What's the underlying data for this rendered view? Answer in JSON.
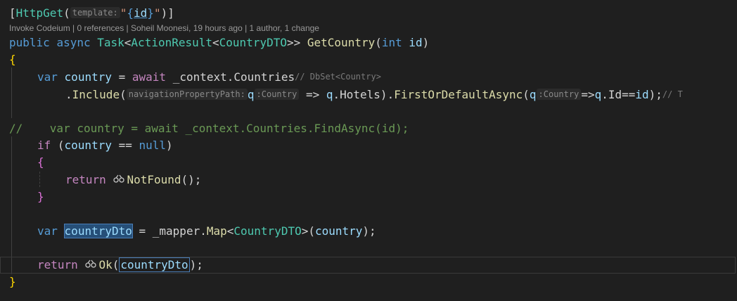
{
  "codelens": {
    "text": "Invoke Codeium | 0 references | Soheil Moonesi, 19 hours ago | 1 author, 1 change"
  },
  "hints": {
    "template": "template:",
    "navigation": "navigationPropertyPath:",
    "type_country_1": ":Country",
    "type_country_2": ":Country",
    "dbset_comment": "// DbSet<Country>",
    "trailing_comment": "// T"
  },
  "code": {
    "l1_open": "[",
    "l1_httpget": "HttpGet",
    "l1_paren": "(",
    "l1_quote_open": "\"",
    "l1_brace_open": "{",
    "l1_id": "id",
    "l1_brace_close": "}",
    "l1_quote_close": "\"",
    "l1_close": ")]",
    "l2_public": "public",
    "l2_async": "async",
    "l2_task": "Task",
    "l2_lt1": "<",
    "l2_actionresult": "ActionResult",
    "l2_lt2": "<",
    "l2_countrydto": "CountryDTO",
    "l2_gt": ">>",
    "l2_getcountry": "GetCountry",
    "l2_paren_open": "(",
    "l2_int": "int",
    "l2_id": "id",
    "l2_paren_close": ")",
    "l3_brace": "{",
    "l4_var": "var",
    "l4_country": "country",
    "l4_eq": " = ",
    "l4_await": "await",
    "l4_context": " _context.Countries",
    "l5_dot": ".",
    "l5_include": "Include",
    "l5_paren": "(",
    "l5_q": "q",
    "l5_arrow": " => ",
    "l5_q2": "q",
    "l5_hotels": ".Hotels).",
    "l5_first": "FirstOrDefaultAsync",
    "l5_paren2": "(",
    "l5_q3": "q",
    "l5_lambda": "=>",
    "l5_q4": "q",
    "l5_idcmp": ".Id==",
    "l5_id": "id",
    "l5_end": ");",
    "l7_comment": "//    var country = await _context.Countries.FindAsync(id);",
    "l8_if": "if",
    "l8_open": " (",
    "l8_country": "country",
    "l8_eq": " == ",
    "l8_null": "null",
    "l8_close": ")",
    "l9_brace": "{",
    "l10_return": "return",
    "l10_notfound": "NotFound",
    "l10_end": "();",
    "l11_brace": "}",
    "l13_var": "var",
    "l13_countrydto": "countryDto",
    "l13_eq": " = _mapper.",
    "l13_map": "Map",
    "l13_lt": "<",
    "l13_dto": "CountryDTO",
    "l13_gt": ">(",
    "l13_country": "country",
    "l13_end": ");",
    "l15_return": "return",
    "l15_ok": "Ok",
    "l15_paren": "(",
    "l15_countrydto": "countryDto",
    "l15_end": ");",
    "l16_brace": "}"
  },
  "colors": {
    "background": "#1f1f1f",
    "keyword": "#569cd6",
    "control": "#c586c0",
    "type": "#4ec9b0",
    "function": "#dcdcaa",
    "variable": "#9cdcfe",
    "string": "#ce9178",
    "comment": "#6a9955",
    "highlight": "#264f78"
  }
}
